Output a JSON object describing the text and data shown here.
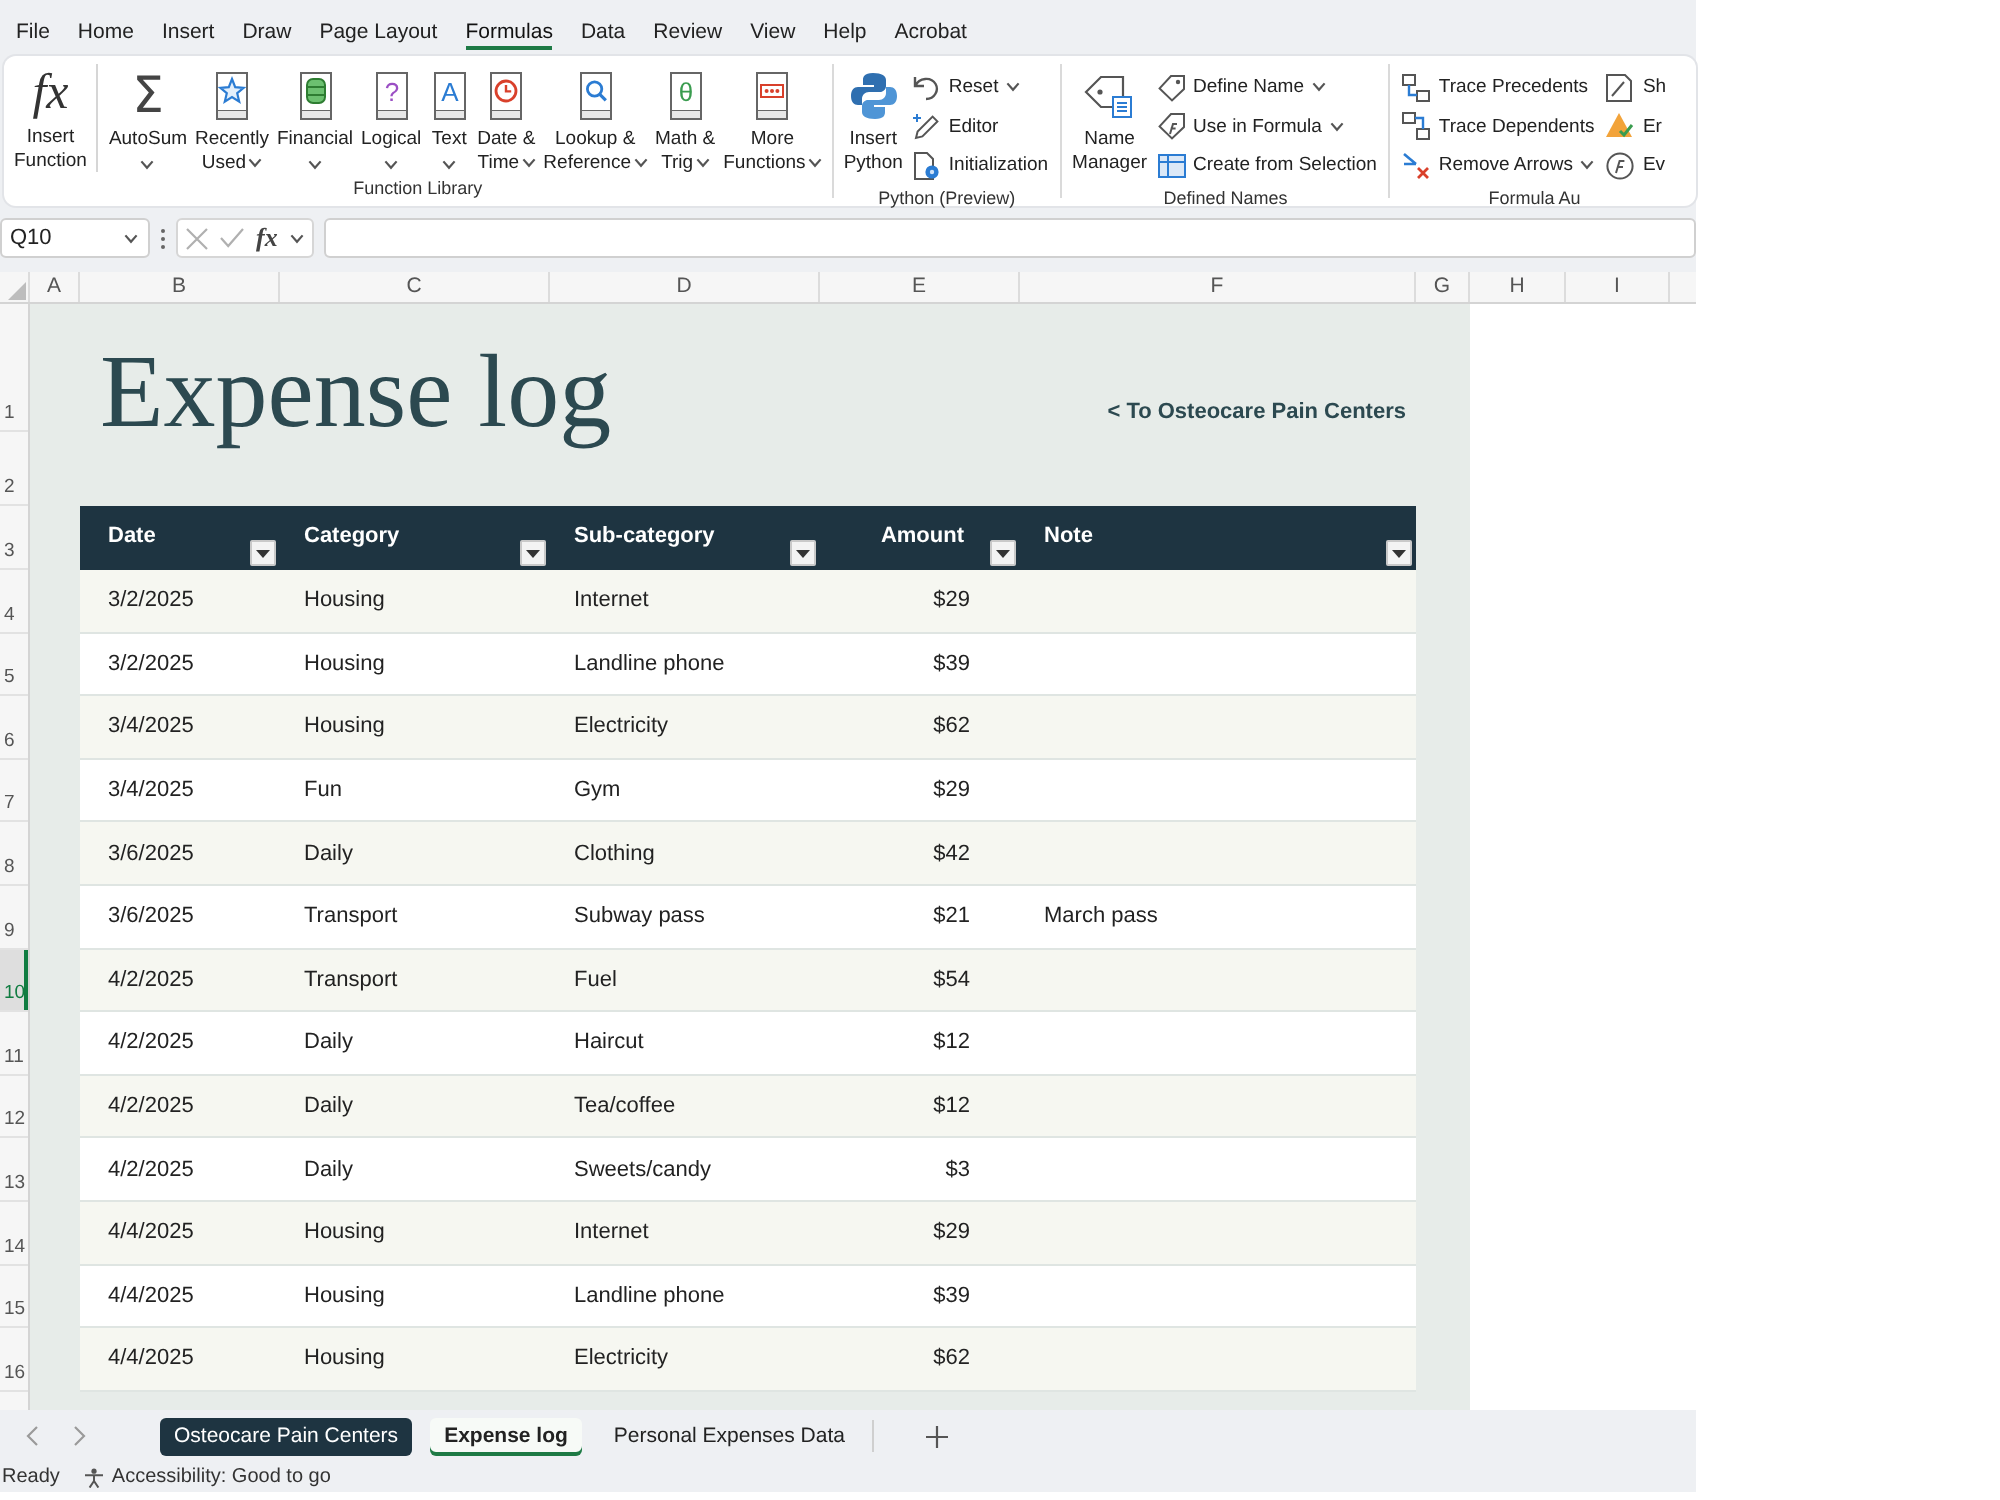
{
  "menu_tabs": [
    {
      "label": "File",
      "selected": false
    },
    {
      "label": "Home",
      "selected": false
    },
    {
      "label": "Insert",
      "selected": false
    },
    {
      "label": "Draw",
      "selected": false
    },
    {
      "label": "Page Layout",
      "selected": false
    },
    {
      "label": "Formulas",
      "selected": true
    },
    {
      "label": "Data",
      "selected": false
    },
    {
      "label": "Review",
      "selected": false
    },
    {
      "label": "View",
      "selected": false
    },
    {
      "label": "Help",
      "selected": false
    },
    {
      "label": "Acrobat",
      "selected": false
    }
  ],
  "ribbon": {
    "groups": [
      {
        "label": "Function Library",
        "items": [
          {
            "kind": "large",
            "glyph": "fx",
            "label": "Insert\nFunction",
            "dropdown": false,
            "divider_after": true
          },
          {
            "kind": "large",
            "glyph": "Σ",
            "label": "AutoSum",
            "dropdown": true,
            "divider_after": false
          },
          {
            "kind": "large",
            "label": "Recently\nUsed",
            "dropdown": true,
            "divider_after": false
          },
          {
            "kind": "large",
            "label": "Financial",
            "dropdown": true,
            "divider_after": false
          },
          {
            "kind": "large",
            "glyph": "?",
            "label": "Logical",
            "dropdown": true,
            "divider_after": false
          },
          {
            "kind": "large",
            "glyph": "A",
            "label": "Text",
            "dropdown": true,
            "divider_after": false
          },
          {
            "kind": "large",
            "label": "Date &\nTime",
            "dropdown": true,
            "divider_after": false
          },
          {
            "kind": "large",
            "label": "Lookup &\nReference",
            "dropdown": true,
            "divider_after": false
          },
          {
            "kind": "large",
            "glyph": "θ",
            "label": "Math &\nTrig",
            "dropdown": true,
            "divider_after": false
          },
          {
            "kind": "large",
            "label": "More\nFunctions",
            "dropdown": true,
            "divider_after": false
          }
        ]
      },
      {
        "label": "Python (Preview)",
        "items": [
          {
            "kind": "large",
            "label": "Insert\nPython",
            "dropdown": false,
            "divider_after": false
          },
          {
            "kind": "small",
            "label": "Reset",
            "dropdown": true,
            "divider_after": false
          },
          {
            "kind": "small",
            "label": "Editor",
            "dropdown": false,
            "divider_after": false
          },
          {
            "kind": "small",
            "label": "Initialization",
            "dropdown": false,
            "divider_after": false
          }
        ]
      },
      {
        "label": "Defined Names",
        "items": [
          {
            "kind": "large",
            "label": "Name\nManager",
            "dropdown": false,
            "divider_after": false
          },
          {
            "kind": "small",
            "label": "Define Name",
            "dropdown": true,
            "divider_after": false
          },
          {
            "kind": "small",
            "label": "Use in Formula",
            "dropdown": true,
            "divider_after": false
          },
          {
            "kind": "small",
            "label": "Create from Selection",
            "dropdown": false,
            "divider_after": false
          }
        ]
      },
      {
        "label": "Formula Au",
        "items": [
          {
            "kind": "small",
            "label": "Trace Precedents",
            "dropdown": false,
            "divider_after": false
          },
          {
            "kind": "small",
            "label": "Trace Dependents",
            "dropdown": false,
            "divider_after": false
          },
          {
            "kind": "small",
            "label": "Remove Arrows",
            "dropdown": true,
            "divider_after": false
          },
          {
            "kind": "small",
            "label": "Sh",
            "dropdown": false,
            "divider_after": false
          },
          {
            "kind": "small",
            "label": "Er",
            "dropdown": false,
            "divider_after": false
          },
          {
            "kind": "small",
            "label": "Ev",
            "dropdown": false,
            "divider_after": false
          }
        ]
      }
    ]
  },
  "formula_bar": {
    "name_box": "Q10",
    "function_glyph": "fx"
  },
  "sheet": {
    "column_headers": [
      "A",
      "B",
      "C",
      "D",
      "E",
      "F",
      "G",
      "H",
      "I"
    ],
    "row_headers": [
      {
        "label": "1",
        "selected": false
      },
      {
        "label": "2",
        "selected": false
      },
      {
        "label": "3",
        "selected": false
      },
      {
        "label": "4",
        "selected": false
      },
      {
        "label": "5",
        "selected": false
      },
      {
        "label": "6",
        "selected": false
      },
      {
        "label": "7",
        "selected": false
      },
      {
        "label": "8",
        "selected": false
      },
      {
        "label": "9",
        "selected": false
      },
      {
        "label": "10",
        "selected": true
      },
      {
        "label": "11",
        "selected": false
      },
      {
        "label": "12",
        "selected": false
      },
      {
        "label": "13",
        "selected": false
      },
      {
        "label": "14",
        "selected": false
      },
      {
        "label": "15",
        "selected": false
      },
      {
        "label": "16",
        "selected": false
      }
    ],
    "title": "Expense log",
    "link": "< To Osteocare Pain Centers",
    "table": {
      "columns": [
        {
          "label": "Date",
          "kind": "text",
          "filter": true
        },
        {
          "label": "Category",
          "kind": "text",
          "filter": true
        },
        {
          "label": "Sub-category",
          "kind": "text",
          "filter": true
        },
        {
          "label": "Amount",
          "kind": "number",
          "filter": true
        },
        {
          "label": "Note",
          "kind": "text",
          "filter": true
        }
      ],
      "rows": [
        {
          "date": "3/2/2025",
          "category": "Housing",
          "subcategory": "Internet",
          "amount": "$29"
        },
        {
          "date": "3/2/2025",
          "category": "Housing",
          "subcategory": "Landline phone",
          "amount": "$39"
        },
        {
          "date": "3/4/2025",
          "category": "Housing",
          "subcategory": "Electricity",
          "amount": "$62"
        },
        {
          "date": "3/4/2025",
          "category": "Fun",
          "subcategory": "Gym",
          "amount": "$29"
        },
        {
          "date": "3/6/2025",
          "category": "Daily",
          "subcategory": "Clothing",
          "amount": "$42"
        },
        {
          "date": "3/6/2025",
          "category": "Transport",
          "subcategory": "Subway pass",
          "amount": "$21",
          "note": "March pass"
        },
        {
          "date": "4/2/2025",
          "category": "Transport",
          "subcategory": "Fuel",
          "amount": "$54"
        },
        {
          "date": "4/2/2025",
          "category": "Daily",
          "subcategory": "Haircut",
          "amount": "$12"
        },
        {
          "date": "4/2/2025",
          "category": "Daily",
          "subcategory": "Tea/coffee",
          "amount": "$12"
        },
        {
          "date": "4/2/2025",
          "category": "Daily",
          "subcategory": "Sweets/candy",
          "amount": "$3"
        },
        {
          "date": "4/4/2025",
          "category": "Housing",
          "subcategory": "Internet",
          "amount": "$29"
        },
        {
          "date": "4/4/2025",
          "category": "Housing",
          "subcategory": "Landline phone",
          "amount": "$39"
        },
        {
          "date": "4/4/2025",
          "category": "Housing",
          "subcategory": "Electricity",
          "amount": "$62"
        }
      ]
    }
  },
  "sheet_tabs": [
    {
      "label": "Osteocare Pain Centers",
      "selected": false,
      "color": "#1e3441"
    },
    {
      "label": "Expense log",
      "selected": true
    },
    {
      "label": "Personal Expenses Data",
      "selected": false
    }
  ],
  "status_bar": {
    "ready": "Ready",
    "accessibility": "Accessibility: Good to go"
  }
}
